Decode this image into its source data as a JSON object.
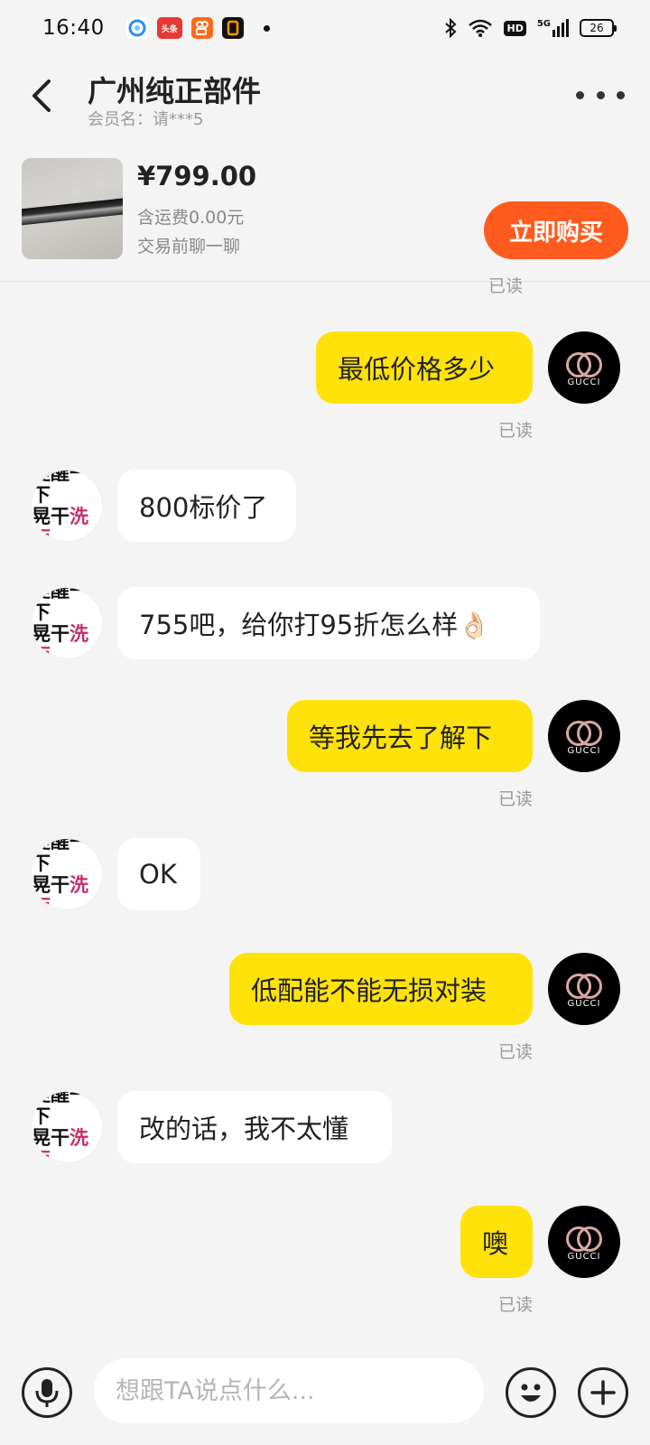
{
  "status_bar": {
    "time": "16:40",
    "app_badge_2": "头条",
    "network": "5G",
    "hd": "HD",
    "battery": "26"
  },
  "header": {
    "title": "广州纯正部件",
    "member": "会员名：请***5"
  },
  "product": {
    "price": "¥799.00",
    "shipping": "含运费0.00元",
    "note": "交易前聊一聊",
    "buy_label": "立即购买"
  },
  "messages": [
    {
      "from": "me",
      "text": "已读",
      "kind": "receipt"
    },
    {
      "from": "me",
      "text": "最低价格多少",
      "read": "已读"
    },
    {
      "from": "them",
      "text": "800标价了"
    },
    {
      "from": "them",
      "text": "755吧，给你打95折怎么样👌🏻"
    },
    {
      "from": "me",
      "text": "等我先去了解下",
      "read": "已读"
    },
    {
      "from": "them",
      "text": "OK"
    },
    {
      "from": "me",
      "text": "低配能不能无损对装",
      "read": "已读"
    },
    {
      "from": "them",
      "text": "改的话，我不太懂"
    },
    {
      "from": "me",
      "text": "噢",
      "read": "已读"
    }
  ],
  "avatars": {
    "me_text": "GUCCI",
    "them_line1": "提醒一下",
    "them_line2a": "晃干",
    "them_line2b": "洗面"
  },
  "input": {
    "placeholder": "想跟TA说点什么..."
  },
  "colors": {
    "my_bubble": "#ffe20a",
    "buy_button": "#ff5b1f",
    "background": "#f4f4f4"
  }
}
